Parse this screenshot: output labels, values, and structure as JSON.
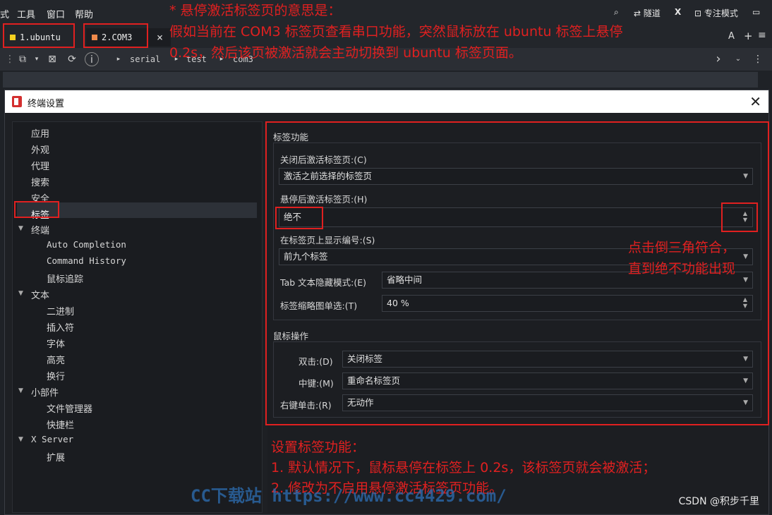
{
  "menubar": {
    "items": [
      "式",
      "工具",
      "窗口",
      "帮助"
    ],
    "right": {
      "tunnel": "隧道",
      "x": "X",
      "focus": "专注模式"
    }
  },
  "tabs": [
    {
      "label": "1.ubuntu",
      "color": "#f5d020"
    },
    {
      "label": "2.COM3",
      "color": "#f08a4b"
    }
  ],
  "tabbar_right": {
    "font": "A",
    "add": "+",
    "menu": "≡"
  },
  "breadcrumb": [
    "serial",
    "test",
    "com3"
  ],
  "dialog": {
    "title": "终端设置",
    "nav": [
      {
        "label": "应用"
      },
      {
        "label": "外观"
      },
      {
        "label": "代理"
      },
      {
        "label": "搜索"
      },
      {
        "label": "安全"
      },
      {
        "label": "标签"
      },
      {
        "label": "终端"
      },
      {
        "label": "Auto Completion"
      },
      {
        "label": "Command History"
      },
      {
        "label": "鼠标追踪"
      },
      {
        "label": "文本"
      },
      {
        "label": "二进制"
      },
      {
        "label": "插入符"
      },
      {
        "label": "字体"
      },
      {
        "label": "高亮"
      },
      {
        "label": "换行"
      },
      {
        "label": "小部件"
      },
      {
        "label": "文件管理器"
      },
      {
        "label": "快捷栏"
      },
      {
        "label": "X Server"
      },
      {
        "label": "扩展"
      }
    ],
    "tab_group": {
      "title": "标签功能",
      "close_activate_label": "关闭后激活标签页:(C)",
      "close_activate_value": "激活之前选择的标签页",
      "hover_activate_label": "悬停后激活标签页:(H)",
      "hover_activate_value": "绝不",
      "show_number_label": "在标签页上显示编号:(S)",
      "show_number_value": "前九个标签",
      "hide_mode_label": "Tab 文本隐藏模式:(E)",
      "hide_mode_value": "省略中间",
      "thumb_label": "标签缩略图单选:(T)",
      "thumb_value": "40 %"
    },
    "mouse_group": {
      "title": "鼠标操作",
      "double_label": "双击:(D)",
      "double_value": "关闭标签",
      "middle_label": "中键:(M)",
      "middle_value": "重命名标签页",
      "right_label": "右键单击:(R)",
      "right_value": "无动作"
    }
  },
  "annotations": {
    "top_line1": "* 悬停激活标签页的意思是：",
    "top_line2": "假如当前在 COM3 标签页查看串口功能，突然鼠标放在 ubuntu 标签上悬停",
    "top_line3": "0.2s，然后该页被激活就会主动切换到 ubuntu 标签页面。",
    "side_line1": "点击倒三角符合，",
    "side_line2": "直到绝不功能出现",
    "bottom_line1": "设置标签功能：",
    "bottom_line2": "1. 默认情况下，鼠标悬停在标签上 0.2s，该标签页就会被激活；",
    "bottom_line3": "2. 修改为不启用悬停激活标签页功能。",
    "watermark": "CC下载站 https://www.cc4429.com/",
    "csdn": "CSDN @积步千里"
  },
  "colors": {
    "annotation_red": "#e02020"
  }
}
